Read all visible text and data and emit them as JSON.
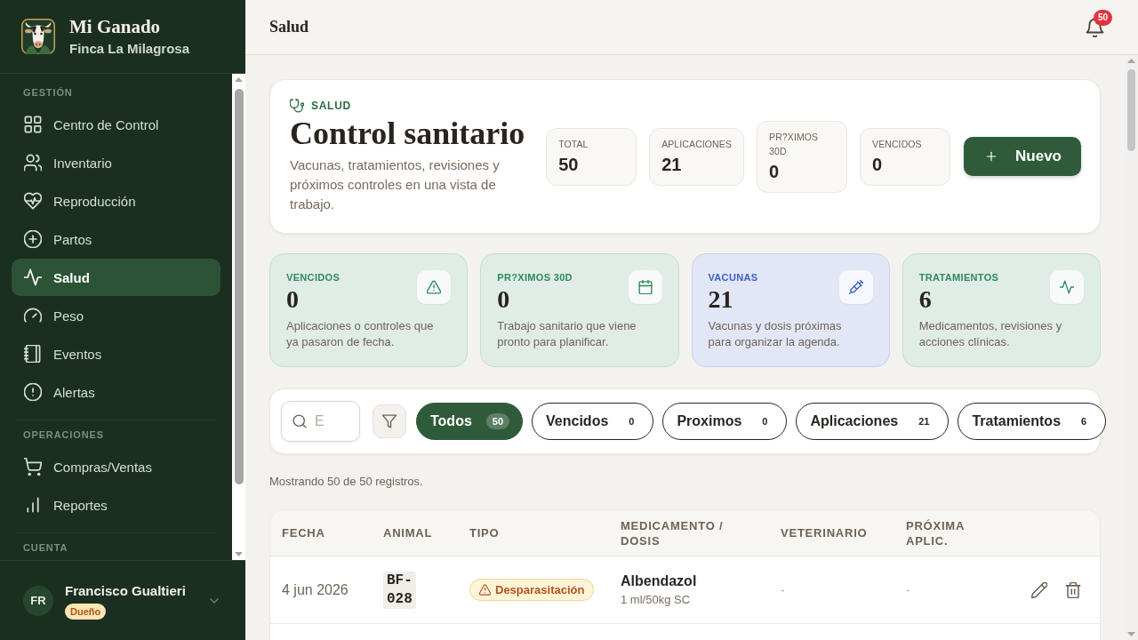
{
  "sidebar": {
    "brand": {
      "title": "Mi Ganado",
      "subtitle": "Finca La Milagrosa"
    },
    "sections": [
      {
        "label": "GESTIÓN",
        "items": [
          {
            "label": "Centro de Control",
            "selected": false
          },
          {
            "label": "Inventario",
            "selected": false
          },
          {
            "label": "Reproducción",
            "selected": false
          },
          {
            "label": "Partos",
            "selected": false
          },
          {
            "label": "Salud",
            "selected": true
          },
          {
            "label": "Peso",
            "selected": false
          },
          {
            "label": "Eventos",
            "selected": false
          },
          {
            "label": "Alertas",
            "selected": false
          }
        ]
      },
      {
        "label": "OPERACIONES",
        "items": [
          {
            "label": "Compras/Ventas",
            "selected": false
          },
          {
            "label": "Reportes",
            "selected": false
          }
        ]
      },
      {
        "label": "CUENTA"
      }
    ],
    "user": {
      "initials": "FR",
      "name": "Francisco Gualtieri",
      "role": "Dueño"
    }
  },
  "header": {
    "title": "Salud",
    "notification_count": "50"
  },
  "hero": {
    "eyebrow": "SALUD",
    "title": "Control sanitario",
    "description": "Vacunas, tratamientos, revisiones y próximos controles en una vista de trabajo.",
    "stats": [
      {
        "label": "TOTAL",
        "value": "50"
      },
      {
        "label": "APLICACIONES",
        "value": "21"
      },
      {
        "label": "PR?XIMOS 30D",
        "value": "0"
      },
      {
        "label": "VENCIDOS",
        "value": "0"
      }
    ],
    "new_button": "Nuevo"
  },
  "summary_cards": [
    {
      "label": "VENCIDOS",
      "value": "0",
      "description": "Aplicaciones o controles que ya pasaron de fecha.",
      "color": "#2f8a5b"
    },
    {
      "label": "PR?XIMOS 30D",
      "value": "0",
      "description": "Trabajo sanitario que viene pronto para planificar.",
      "color": "#2f8a5b"
    },
    {
      "label": "VACUNAS",
      "value": "21",
      "description": "Vacunas y dosis próximas para organizar la agenda.",
      "color": "#3d60c8"
    },
    {
      "label": "TRATAMIENTOS",
      "value": "6",
      "description": "Medicamentos, revisiones y acciones clínicas.",
      "color": "#2f8a5b"
    }
  ],
  "filters": {
    "search": {
      "placeholder": "E"
    },
    "chips": [
      {
        "label": "Todos",
        "count": "50",
        "selected": true
      },
      {
        "label": "Vencidos",
        "count": "0",
        "selected": false
      },
      {
        "label": "Proximos",
        "count": "0",
        "selected": false
      },
      {
        "label": "Aplicaciones",
        "count": "21",
        "selected": false
      },
      {
        "label": "Tratamientos",
        "count": "6",
        "selected": false
      }
    ]
  },
  "result_summary": "Mostrando 50 de 50 registros.",
  "table": {
    "columns": [
      "FECHA",
      "ANIMAL",
      "TIPO",
      "MEDICAMENTO / DOSIS",
      "VETERINARIO",
      "PRÓXIMA APLIC."
    ],
    "rows": [
      {
        "date": "4 jun 2026",
        "animal": "BF-028",
        "type": "Desparasitación",
        "medication": "Albendazol",
        "dose": "1 ml/50kg SC",
        "veterinarian": "-",
        "next_application": "-"
      }
    ]
  }
}
